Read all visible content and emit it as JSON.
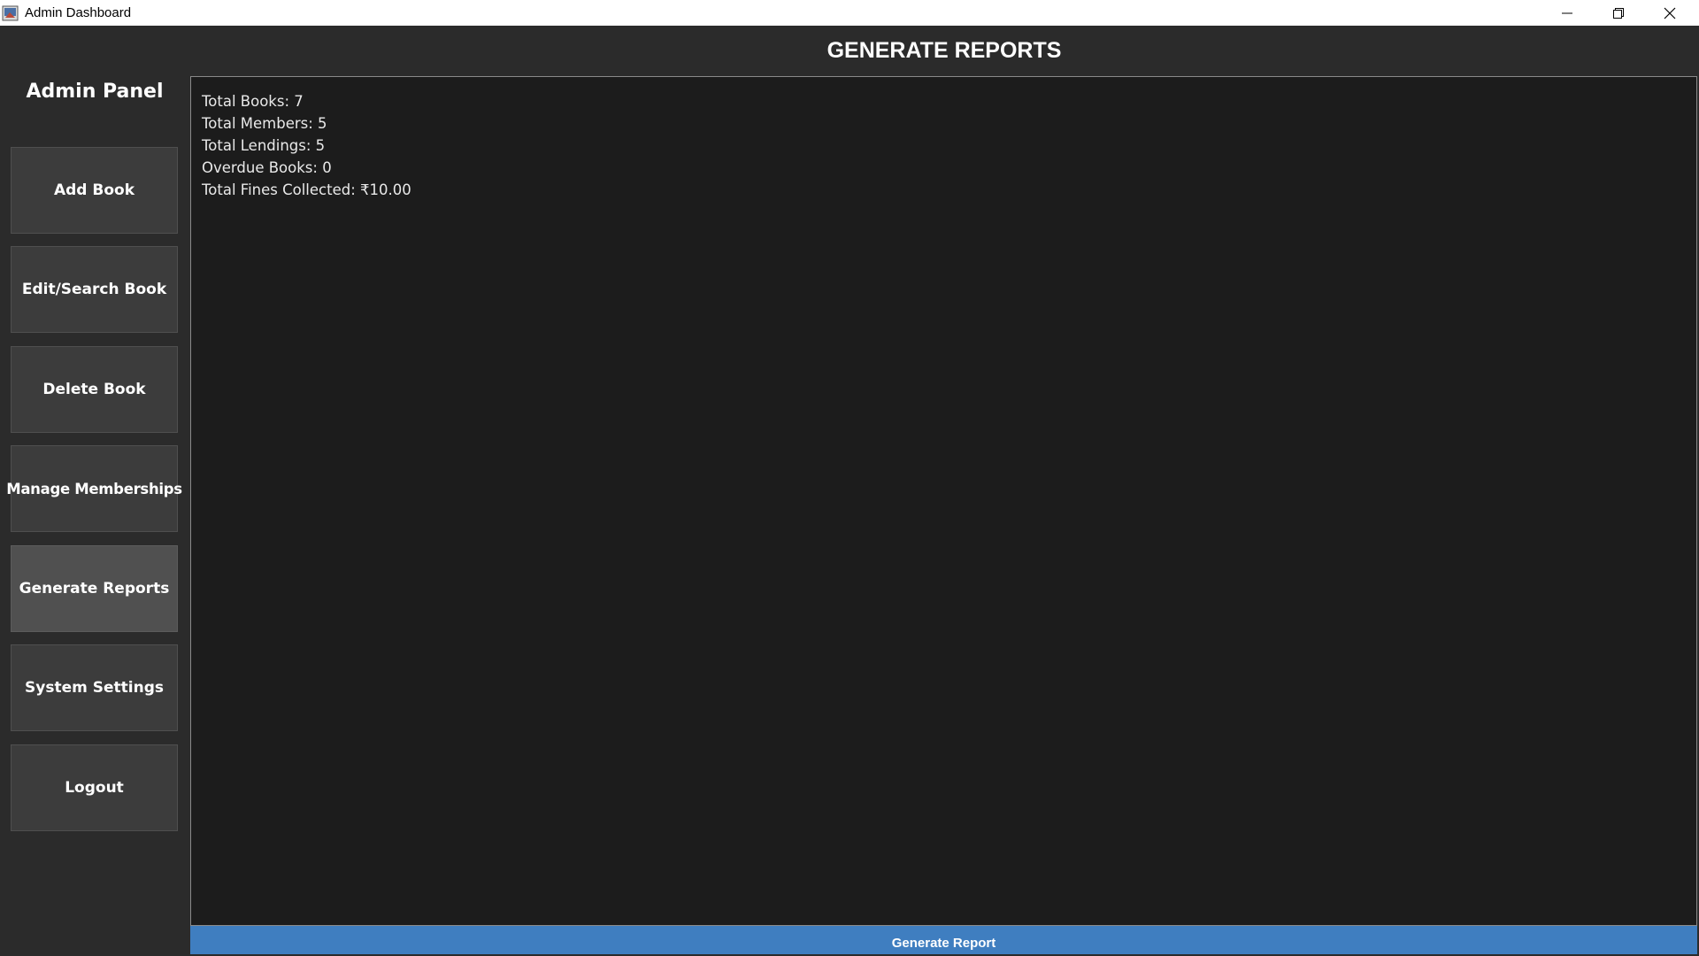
{
  "window": {
    "title": "Admin Dashboard",
    "app_icon": "java-app-icon",
    "controls": {
      "minimize_icon": "minimize-icon",
      "restore_icon": "restore-icon",
      "close_icon": "close-icon"
    }
  },
  "sidebar": {
    "title": "Admin Panel",
    "items": [
      {
        "label": "Add Book",
        "active": false
      },
      {
        "label": "Edit/Search Book",
        "active": false
      },
      {
        "label": "Delete Book",
        "active": false
      },
      {
        "label": "Manage Memberships",
        "active": false
      },
      {
        "label": "Generate Reports",
        "active": true
      },
      {
        "label": "System Settings",
        "active": false
      },
      {
        "label": "Logout",
        "active": false
      }
    ]
  },
  "main": {
    "title": "GENERATE REPORTS",
    "report_lines": [
      "Total Books: 7",
      "Total Members: 5",
      "Total Lendings: 5",
      "Overdue Books: 0",
      "Total Fines Collected: ₹10.00"
    ],
    "generate_button_label": "Generate Report"
  },
  "colors": {
    "background": "#2b2b2b",
    "sidebar_button": "#3c3c3c",
    "sidebar_button_active": "#505050",
    "report_area": "#1c1c1c",
    "accent_button": "#3f7ec0",
    "text": "#ffffff"
  }
}
